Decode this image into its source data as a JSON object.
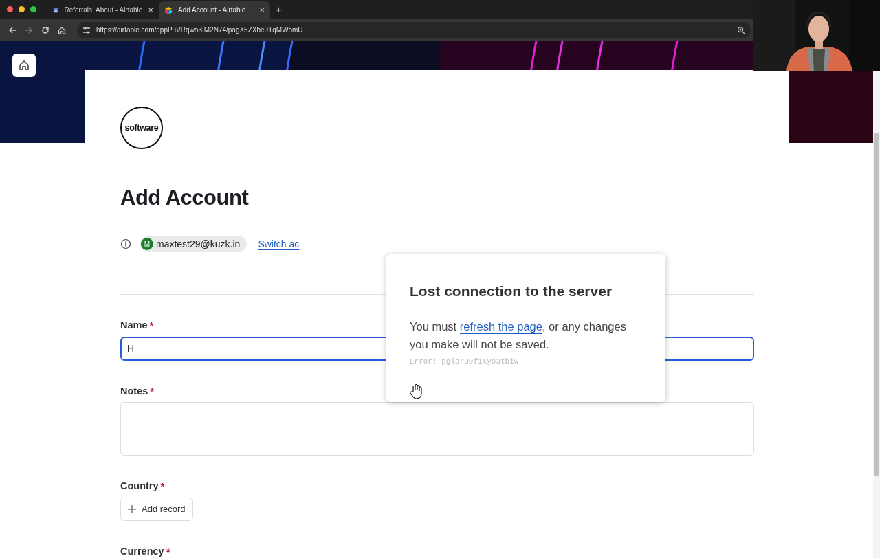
{
  "browser": {
    "tabs": [
      {
        "title": "Referrals: About - Airtable",
        "close": "×",
        "selected": false
      },
      {
        "title": "Add Account - Airtable",
        "close": "×",
        "selected": true
      }
    ],
    "new_tab": "+",
    "forward_disabled": true,
    "url": "https://airtable.com/appPuVRqwo3IM2N74/pagX5ZXbe9TqMWomU"
  },
  "form": {
    "logo_text": "software",
    "title": "Add Account",
    "user": {
      "avatar_initial": "M",
      "email": "maxtest29@kuzk.in"
    },
    "switch_link": "Switch ac",
    "fields": [
      {
        "label": "Name",
        "required": "*",
        "kind": "text",
        "value": "H",
        "focused": true
      },
      {
        "label": "Notes",
        "required": "*",
        "kind": "textarea"
      },
      {
        "label": "Country",
        "required": "*",
        "kind": "record",
        "button": "Add record"
      },
      {
        "label": "Currency",
        "required": "*",
        "kind": "record"
      }
    ]
  },
  "dialog": {
    "title": "Lost connection to the server",
    "message_before": "You must ",
    "link": "refresh the page",
    "message_after": ", or any changes you make will not be saved.",
    "error": "Error: pglarU9f1Xyo3tbiw"
  }
}
